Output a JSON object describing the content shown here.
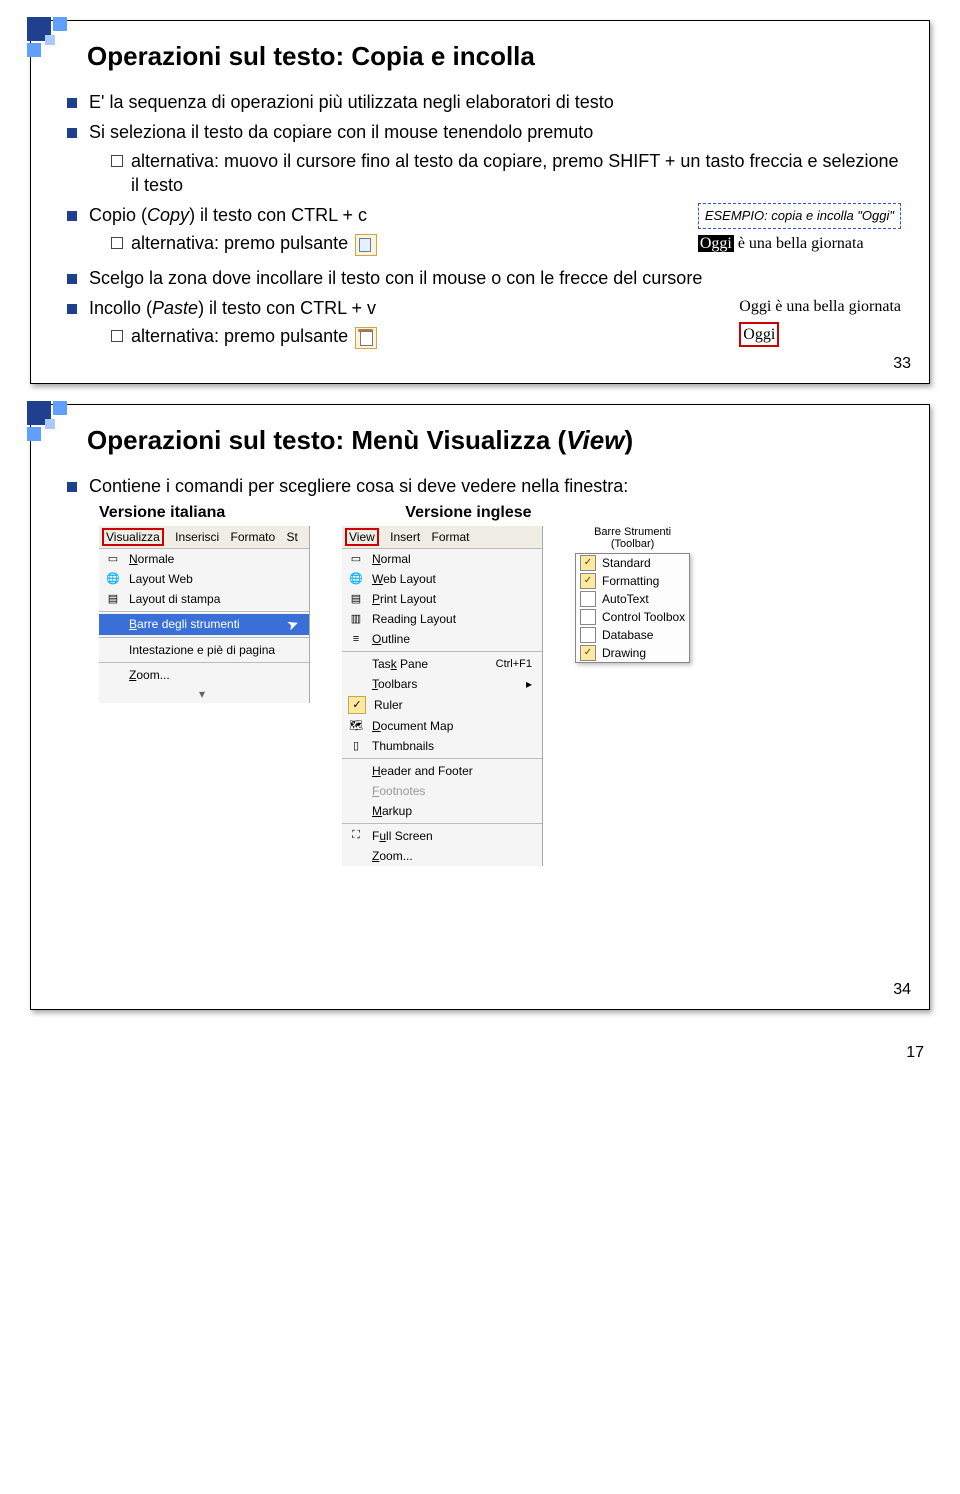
{
  "slide1": {
    "title": "Operazioni sul testo: Copia e incolla",
    "b1": "E' la sequenza di operazioni più utilizzata negli elaboratori di testo",
    "b2": "Si seleziona il testo da copiare con il mouse tenendolo premuto",
    "b2a": "alternativa: muovo il cursore fino al testo da copiare, premo SHIFT + un tasto freccia e selezione il testo",
    "b3_pre": "Copio (",
    "b3_it": "Copy",
    "b3_post": ") il testo con CTRL + c",
    "b3a": "alternativa: premo pulsante",
    "example_label": "ESEMPIO:",
    "example_text": " copia e incolla \"Oggi\"",
    "example_line": "è una bella giornata",
    "example_sel": "Oggi",
    "b4": "Scelgo la zona dove incollare il testo con il mouse o con le frecce del cursore",
    "b5_pre": "Incollo (",
    "b5_it": "Paste",
    "b5_post": ") il testo con CTRL + v",
    "b5a": "alternativa: premo pulsante",
    "result_line1": "Oggi è una bella giornata",
    "result_line2": "Oggi",
    "page_num": "33"
  },
  "slide2": {
    "title_pre": "Operazioni sul testo: Menù Visualizza (",
    "title_it": "View",
    "title_post": ")",
    "b1": "Contiene i comandi per scegliere cosa si deve vedere nella finestra:",
    "col_it": "Versione italiana",
    "col_en": "Versione inglese",
    "it_menubar": {
      "v": "Visualizza",
      "i": "Inserisci",
      "f": "Formato",
      "s": "St"
    },
    "it_items": {
      "normale": "Normale",
      "layout_web": "Layout Web",
      "layout_stampa": "Layout di stampa",
      "barre": "Barre degli strumenti",
      "intestazione": "Intestazione e piè di pagina",
      "zoom": "Zoom..."
    },
    "en_menubar": {
      "v": "View",
      "i": "Insert",
      "f": "Format"
    },
    "en_items": {
      "normal": "Normal",
      "web": "Web Layout",
      "print": "Print Layout",
      "reading": "Reading Layout",
      "outline": "Outline",
      "taskpane": "Task Pane",
      "taskpane_shortcut": "Ctrl+F1",
      "toolbars": "Toolbars",
      "ruler": "Ruler",
      "docmap": "Document Map",
      "thumbs": "Thumbnails",
      "header": "Header and Footer",
      "footnotes": "Footnotes",
      "markup": "Markup",
      "fullscreen": "Full Screen",
      "zoom": "Zoom..."
    },
    "flyout_title": "Barre Strumenti",
    "flyout_sub": "(Toolbar)",
    "flyout_items": {
      "standard": "Standard",
      "formatting": "Formatting",
      "autotext": "AutoText",
      "controltb": "Control Toolbox",
      "database": "Database",
      "drawing": "Drawing"
    },
    "page_num": "34"
  },
  "master_page": "17"
}
